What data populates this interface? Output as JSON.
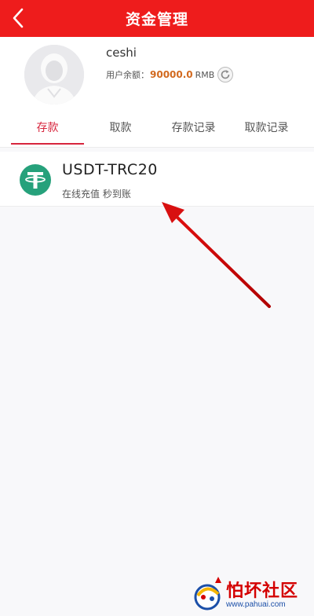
{
  "header": {
    "title": "资金管理",
    "back_icon": "chevron-left-icon",
    "background_color": "#ee1c1c"
  },
  "profile": {
    "username": "ceshi",
    "balance_label": "用户余额：",
    "balance_amount": "90000.0",
    "balance_unit": "RMB",
    "refresh_icon": "refresh-icon",
    "balance_color": "#d2691e"
  },
  "tabs": [
    {
      "label": "存款",
      "active": true
    },
    {
      "label": "取款",
      "active": false
    },
    {
      "label": "存款记录",
      "active": false
    },
    {
      "label": "取款记录",
      "active": false
    }
  ],
  "accent_color": "#d7263d",
  "deposit_methods": [
    {
      "icon": "tether-usdt-icon",
      "icon_color": "#26a17b",
      "title": "USDT-TRC20",
      "description": "在线充值 秒到账"
    }
  ],
  "watermark": {
    "title": "怕坏社区",
    "url": "www.pahuai.com"
  }
}
